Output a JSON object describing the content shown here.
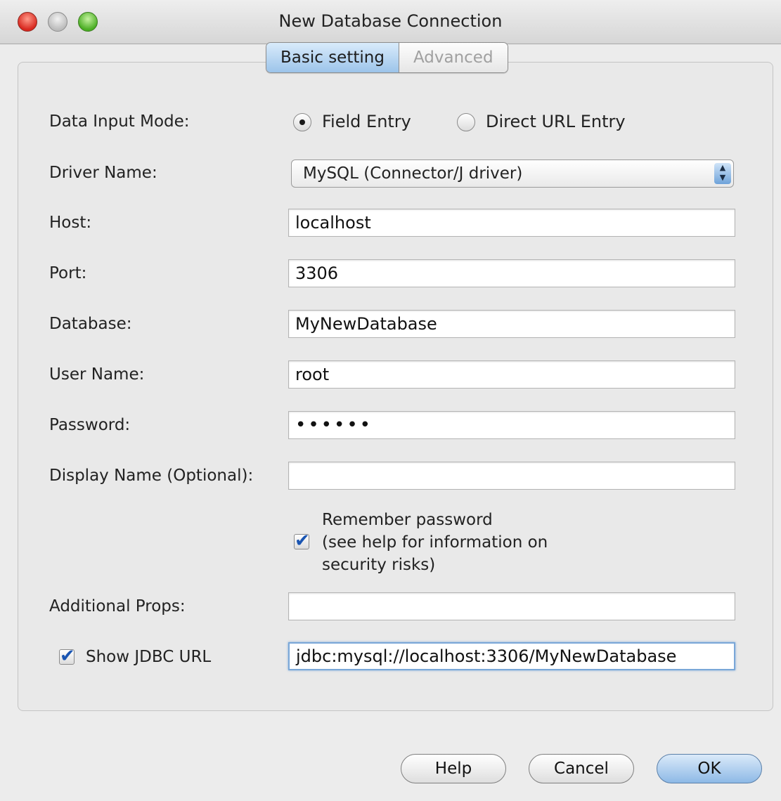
{
  "window": {
    "title": "New Database Connection"
  },
  "tabs": [
    {
      "label": "Basic setting",
      "active": true
    },
    {
      "label": "Advanced",
      "active": false
    }
  ],
  "form": {
    "data_input_mode": {
      "label": "Data Input Mode:",
      "options": [
        {
          "label": "Field Entry",
          "selected": true
        },
        {
          "label": "Direct URL Entry",
          "selected": false
        }
      ]
    },
    "driver_name": {
      "label": "Driver Name:",
      "value": "MySQL (Connector/J driver)",
      "stepper_up": "▲",
      "stepper_down": "▼"
    },
    "host": {
      "label": "Host:",
      "value": "localhost"
    },
    "port": {
      "label": "Port:",
      "value": "3306"
    },
    "database": {
      "label": "Database:",
      "value": "MyNewDatabase"
    },
    "user_name": {
      "label": "User Name:",
      "value": "root"
    },
    "password": {
      "label": "Password:",
      "value": "••••••"
    },
    "display_name": {
      "label": "Display Name (Optional):",
      "value": ""
    },
    "remember_password": {
      "checked": true,
      "lines": [
        "Remember password",
        "(see help for information on",
        "security risks)"
      ]
    },
    "additional_props": {
      "label": "Additional Props:",
      "value": ""
    },
    "show_jdbc_url": {
      "label": "Show JDBC URL",
      "checked": true,
      "value": "jdbc:mysql://localhost:3306/MyNewDatabase"
    }
  },
  "buttons": {
    "help": "Help",
    "cancel": "Cancel",
    "ok": "OK"
  },
  "check_glyph": "✔",
  "colors": {
    "accent": "#8db9e6",
    "close": "#d8281f",
    "zoom": "#4bae24"
  }
}
